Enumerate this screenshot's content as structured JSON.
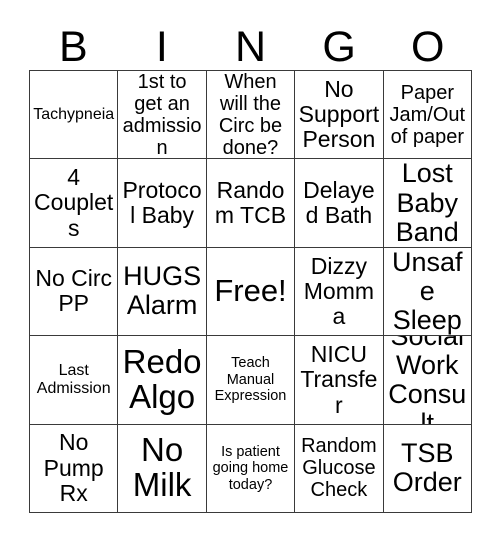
{
  "header": {
    "letters": [
      "B",
      "I",
      "N",
      "G",
      "O"
    ]
  },
  "grid": {
    "rows": 5,
    "columns": 5,
    "border_color": "#3a3a3a",
    "background_color": "#ffffff",
    "text_color": "#000000",
    "cells": [
      {
        "text": "Tachypneia",
        "size": "fs-sm"
      },
      {
        "text": "1st to get an admission",
        "size": "fs-md"
      },
      {
        "text": "When will the Circ be done?",
        "size": "fs-md"
      },
      {
        "text": "No Support Person",
        "size": "fs-lg"
      },
      {
        "text": "Paper Jam/Out of paper",
        "size": "fs-md"
      },
      {
        "text": "4 Couplets",
        "size": "fs-lg"
      },
      {
        "text": "Protocol Baby",
        "size": "fs-lg"
      },
      {
        "text": "Random TCB",
        "size": "fs-lg"
      },
      {
        "text": "Delayed Bath",
        "size": "fs-lg"
      },
      {
        "text": "Lost Baby Band",
        "size": "fs-xl"
      },
      {
        "text": "No Circ PP",
        "size": "fs-lg"
      },
      {
        "text": "HUGS Alarm",
        "size": "fs-xl"
      },
      {
        "text": "Free!",
        "size": "fs-free"
      },
      {
        "text": "Dizzy Momma",
        "size": "fs-lg"
      },
      {
        "text": "Unsafe Sleep",
        "size": "fs-xl"
      },
      {
        "text": "Last Admission",
        "size": "fs-sm"
      },
      {
        "text": "Redo Algo",
        "size": "fs-xxl"
      },
      {
        "text": "Teach Manual Expression",
        "size": "fs-xs"
      },
      {
        "text": "NICU Transfer",
        "size": "fs-lg"
      },
      {
        "text": "Social Work Consult",
        "size": "fs-xl"
      },
      {
        "text": "No Pump Rx",
        "size": "fs-lg"
      },
      {
        "text": "No Milk",
        "size": "fs-xxl"
      },
      {
        "text": "Is patient going home today?",
        "size": "fs-xs"
      },
      {
        "text": "Random Glucose Check",
        "size": "fs-md"
      },
      {
        "text": "TSB Order",
        "size": "fs-xl"
      }
    ]
  }
}
